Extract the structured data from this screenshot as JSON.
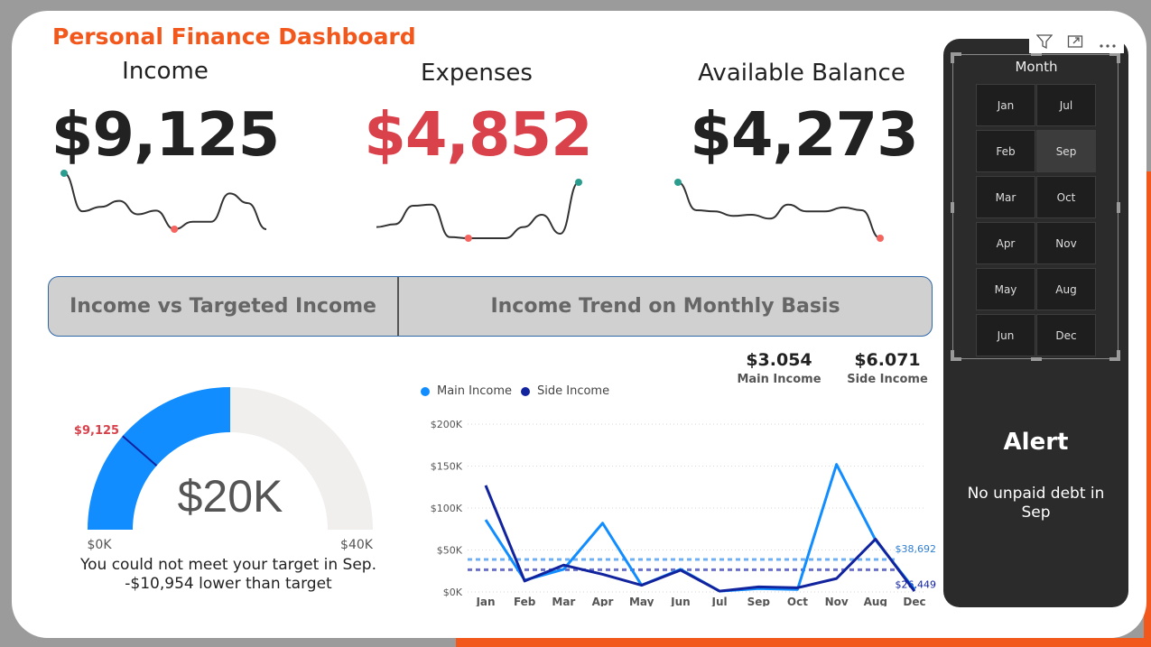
{
  "header": {
    "title": "Personal Finance Dashboard"
  },
  "kpis": {
    "income": {
      "label": "Income",
      "value": "$9,125"
    },
    "expenses": {
      "label": "Expenses",
      "value": "$4,852"
    },
    "balance": {
      "label": "Available Balance",
      "value": "$4,273"
    }
  },
  "tabs": {
    "tab1": "Income vs Targeted Income",
    "tab2": "Income Trend on Monthly Basis"
  },
  "gauge": {
    "center_value": "$20K",
    "min_label": "$0K",
    "max_label": "$40K",
    "actual_label": "$9,125",
    "fill_fraction": 0.5,
    "actual_fraction": 0.228,
    "message_line1": "You could not meet your target in Sep.",
    "message_line2": "-$10,954 lower than target",
    "colors": {
      "fill": "#118dff",
      "track": "#f0efee",
      "marker": "#12239e",
      "actual_label": "#d9414b"
    }
  },
  "summary": {
    "main_income_value": "$3.054",
    "main_income_label": "Main Income",
    "side_income_value": "$6.071",
    "side_income_label": "Side Income"
  },
  "chart_data": {
    "type": "line",
    "categories": [
      "Jan",
      "Feb",
      "Mar",
      "Apr",
      "May",
      "Jun",
      "Jul",
      "Sep",
      "Oct",
      "Nov",
      "Aug",
      "Dec"
    ],
    "ylim": [
      0,
      200000
    ],
    "yticks": [
      "$0K",
      "$50K",
      "$100K",
      "$150K",
      "$200K"
    ],
    "ytick_values": [
      0,
      50000,
      100000,
      150000,
      200000
    ],
    "series": [
      {
        "name": "Main Income",
        "color": "#118dff",
        "values": [
          86000,
          14000,
          27000,
          82000,
          8000,
          27000,
          1000,
          4000,
          3000,
          152000,
          62000,
          3000
        ]
      },
      {
        "name": "Side Income",
        "color": "#12239e",
        "values": [
          127000,
          13000,
          32000,
          21000,
          8000,
          26000,
          1000,
          6000,
          5000,
          16000,
          63000,
          1000
        ]
      }
    ],
    "reference_lines": [
      {
        "value": 38692,
        "label": "$38,692",
        "color": "#6fb0f5"
      },
      {
        "value": 26449,
        "label": "$26,449",
        "color": "#6a70c8"
      }
    ],
    "grid": true,
    "legend_position": "top-left"
  },
  "sparklines": {
    "income": {
      "values": [
        95,
        44,
        50,
        58,
        40,
        45,
        20,
        30,
        30,
        68,
        55,
        20
      ],
      "high_color": "#2a9d8f",
      "low_color": "#f5645f",
      "line_color": "#333333"
    },
    "expenses": {
      "values": [
        20,
        25,
        58,
        60,
        2,
        0,
        0,
        0,
        20,
        42,
        8,
        100
      ],
      "high_color": "#2a9d8f",
      "low_color": "#f5645f",
      "line_color": "#333333"
    },
    "balance": {
      "values": [
        100,
        50,
        48,
        40,
        42,
        35,
        60,
        48,
        48,
        55,
        50,
        0
      ],
      "high_color": "#2a9d8f",
      "low_color": "#f5645f",
      "line_color": "#333333"
    }
  },
  "slicer": {
    "title": "Month",
    "months": [
      "Jan",
      "Jul",
      "Feb",
      "Sep",
      "Mar",
      "Oct",
      "Apr",
      "Nov",
      "May",
      "Aug",
      "Jun",
      "Dec"
    ],
    "selected": "Sep"
  },
  "toolbar": {
    "filter_icon": "filter-icon",
    "expand_icon": "expand-icon",
    "more_icon": "more-options-icon"
  },
  "alert": {
    "title": "Alert",
    "message": "No unpaid debt in Sep"
  }
}
